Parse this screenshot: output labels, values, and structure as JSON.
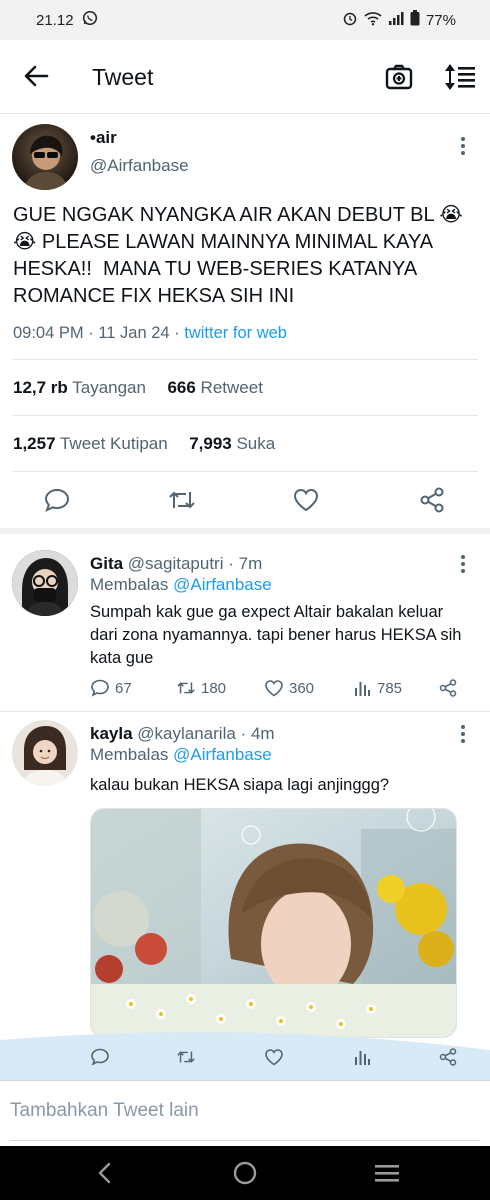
{
  "status_bar": {
    "time": "21.12",
    "battery": "77%"
  },
  "header": {
    "title": "Tweet"
  },
  "main_tweet": {
    "name": "•air",
    "handle": "@Airfanbase",
    "text": "GUE NGGAK NYANGKA AIR AKAN DEBUT BL 😭😭 PLEASE LAWAN MAINNYA MINIMAL KAYA HESKA!!  MANA TU WEB-SERIES KATANYA ROMANCE FIX HEKSA SIH INI",
    "time": "09:04 PM",
    "date": "11 Jan 24",
    "source": "twitter for web",
    "views_count": "12,7 rb",
    "views_label": "Tayangan",
    "retweets_count": "666",
    "retweets_label": "Retweet",
    "quotes_count": "1,257",
    "quotes_label": "Tweet Kutipan",
    "likes_count": "7,993",
    "likes_label": "Suka"
  },
  "replies": [
    {
      "name": "Gita",
      "handle": "@sagitaputri",
      "age": "7m",
      "replying_label": "Membalas",
      "replying_to": "@Airfanbase",
      "text": "Sumpah kak gue ga expect Altair bakalan keluar dari zona nyamannya. tapi bener harus HEKSA sih kata gue",
      "replies": "67",
      "retweets": "180",
      "likes": "360",
      "views": "785"
    },
    {
      "name": "kayla",
      "handle": "@kaylanarila",
      "age": "4m",
      "replying_label": "Membalas",
      "replying_to": "@Airfanbase",
      "text": "kalau bukan HEKSA siapa lagi anjinggg?"
    }
  ],
  "compose": {
    "placeholder": "Tambahkan Tweet lain"
  },
  "icons": {
    "back": "arrow-left-icon",
    "camera": "camera-plus-icon",
    "sort": "sort-icon",
    "reply": "reply-icon",
    "retweet": "retweet-icon",
    "like": "heart-icon",
    "share": "share-icon",
    "views": "bar-chart-icon"
  },
  "colors": {
    "link": "#1d9bf0",
    "muted": "#536471",
    "text": "#0f1419"
  }
}
